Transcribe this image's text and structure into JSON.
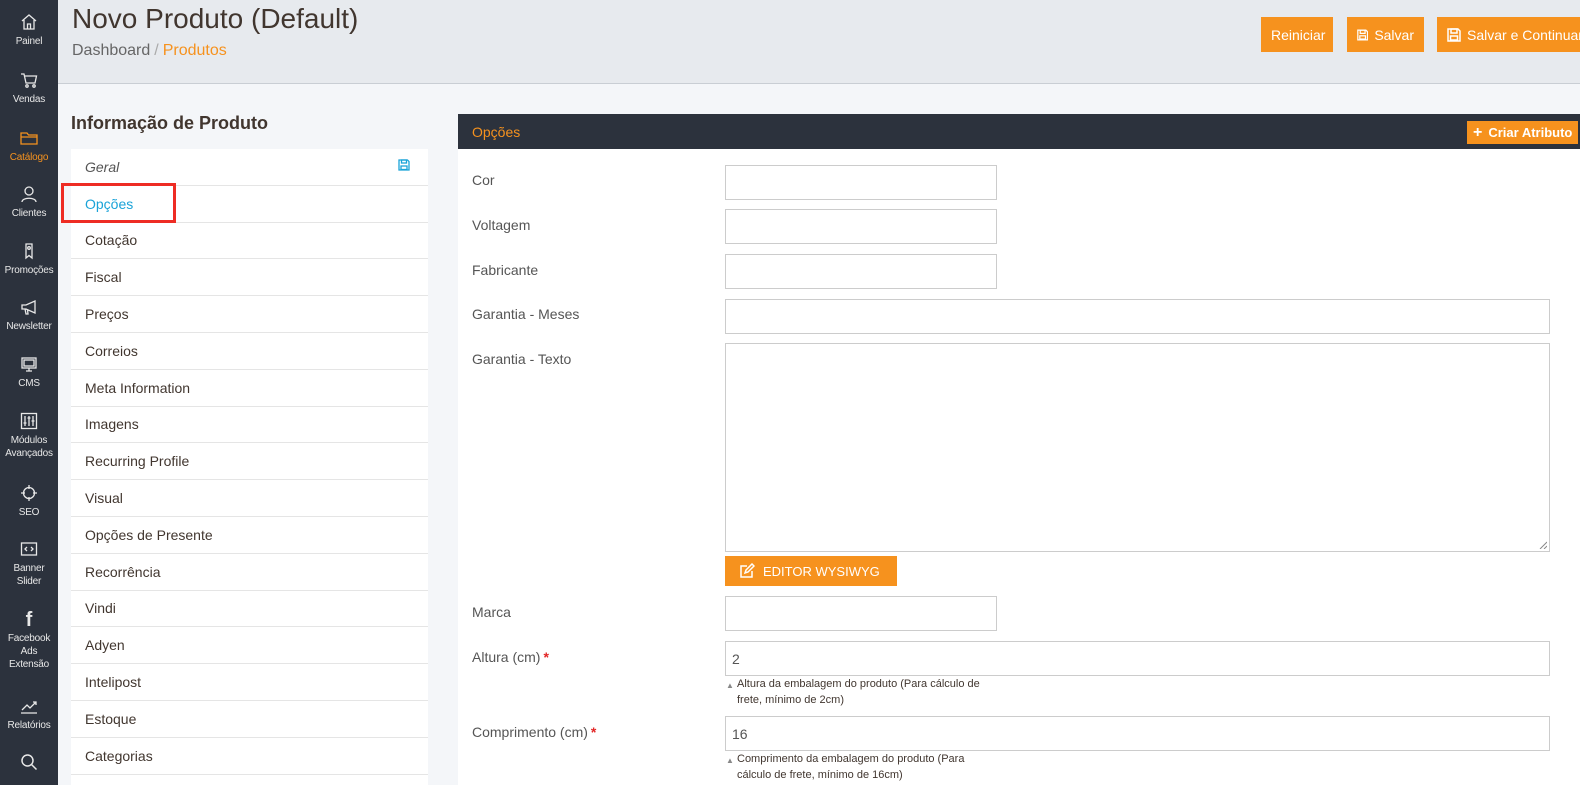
{
  "sidebar": {
    "items": [
      {
        "label": "Painel",
        "icon": "home-icon"
      },
      {
        "label": "Vendas",
        "icon": "cart-icon"
      },
      {
        "label": "Catálogo",
        "icon": "folder-icon",
        "active": true
      },
      {
        "label": "Clientes",
        "icon": "user-icon"
      },
      {
        "label": "Promoções",
        "icon": "tag-icon"
      },
      {
        "label": "Newsletter",
        "icon": "megaphone-icon"
      },
      {
        "label": "CMS",
        "icon": "monitor-icon"
      },
      {
        "label": "Módulos\nAvançados",
        "icon": "sliders-icon"
      },
      {
        "label": "SEO",
        "icon": "crosshair-icon"
      },
      {
        "label": "Banner\nSlider",
        "icon": "code-window-icon"
      },
      {
        "label": "Facebook\nAds\nExtensão",
        "icon": "facebook-icon"
      },
      {
        "label": "Relatórios",
        "icon": "chart-line-icon"
      },
      {
        "label": "",
        "icon": "search-icon"
      }
    ]
  },
  "header": {
    "title": "Novo Produto (Default)",
    "breadcrumb": {
      "root": "Dashboard",
      "separator": "/",
      "current": "Produtos"
    },
    "buttons": {
      "reset": "Reiniciar",
      "save": "Salvar",
      "save_continue": "Salvar e Continuar"
    }
  },
  "product_info": {
    "title": "Informação de Produto",
    "menu": [
      "Geral",
      "Opções",
      "Cotação",
      "Fiscal",
      "Preços",
      "Correios",
      "Meta Information",
      "Imagens",
      "Recurring Profile",
      "Visual",
      "Opções de Presente",
      "Recorrência",
      "Vindi",
      "Adyen",
      "Intelipost",
      "Estoque",
      "Categorias"
    ],
    "active_index": 1
  },
  "panel": {
    "title": "Opções",
    "create_attribute": "Criar Atributo",
    "fields": {
      "cor": {
        "label": "Cor",
        "value": ""
      },
      "voltagem": {
        "label": "Voltagem",
        "value": ""
      },
      "fabricante": {
        "label": "Fabricante",
        "value": ""
      },
      "garantia_meses": {
        "label": "Garantia - Meses",
        "value": ""
      },
      "garantia_texto": {
        "label": "Garantia - Texto",
        "value": ""
      },
      "marca": {
        "label": "Marca",
        "value": ""
      },
      "altura": {
        "label": "Altura (cm)",
        "required": "*",
        "value": "2",
        "note": "Altura da embalagem do produto (Para cálculo de frete, mínimo de 2cm)"
      },
      "comprimento": {
        "label": "Comprimento (cm)",
        "required": "*",
        "value": "16",
        "note": "Comprimento da embalagem do produto (Para cálculo de frete, mínimo de 16cm)"
      }
    },
    "wysiwyg_button": "EDITOR WYSIWYG"
  },
  "colors": {
    "accent": "#f6921e",
    "sidebar": "#2c323d",
    "link_active": "#1aa3d8",
    "highlight": "#ee2c24"
  }
}
